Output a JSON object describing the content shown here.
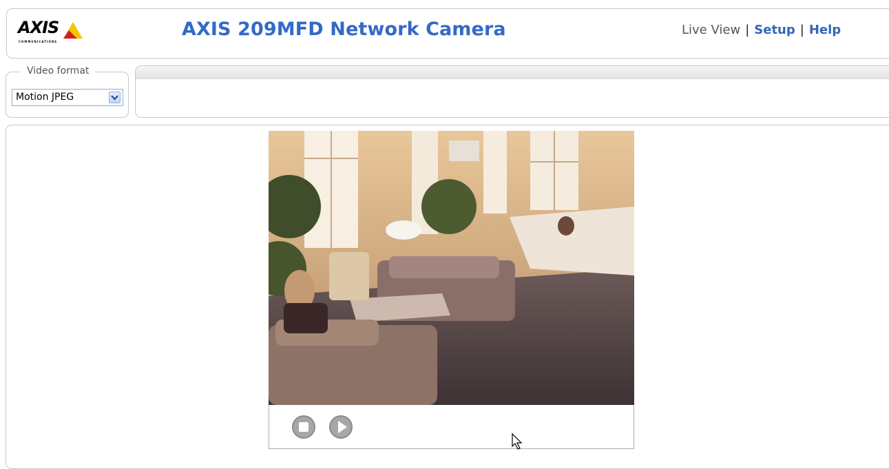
{
  "header": {
    "logo_text": "AXIS",
    "logo_subtext": "COMMUNICATIONS",
    "title": "AXIS 209MFD Network Camera",
    "nav": {
      "current": "Live View",
      "separator": "|",
      "setup": "Setup",
      "help": "Help"
    }
  },
  "video_format": {
    "legend": "Video format",
    "selected": "Motion JPEG"
  },
  "viewer": {
    "controls": [
      {
        "name": "stop",
        "icon": "stop-icon"
      },
      {
        "name": "play",
        "icon": "play-icon"
      }
    ]
  },
  "colors": {
    "title_blue": "#3369c8",
    "link_blue": "#3365b8",
    "logo_yellow": "#f5c400",
    "logo_red": "#d41f1f"
  }
}
